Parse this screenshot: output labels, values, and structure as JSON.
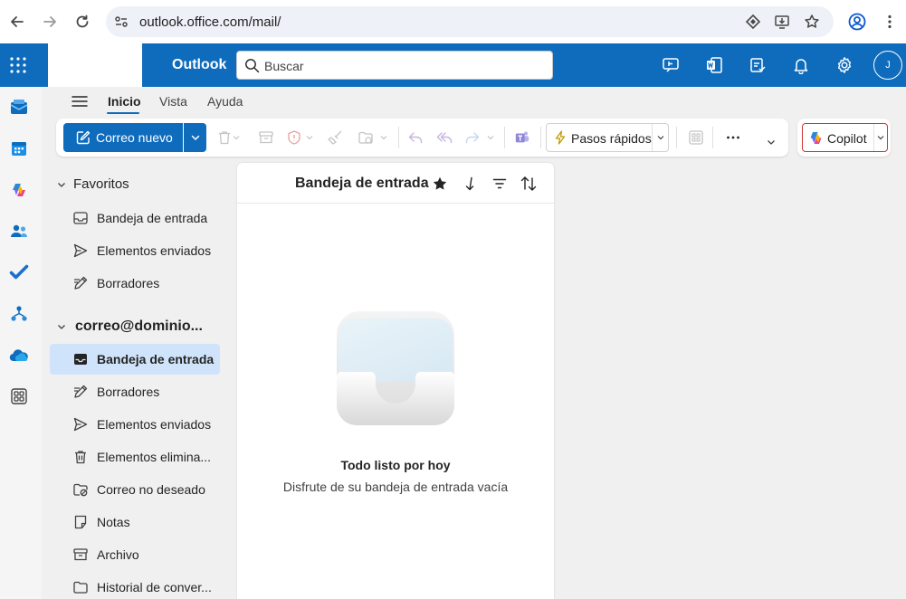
{
  "browser": {
    "url": "outlook.office.com/mail/"
  },
  "header": {
    "app_name": "Outlook",
    "search_placeholder": "Buscar",
    "avatar_initial": "J",
    "brand_color": "#0f6cbd"
  },
  "ribbon": {
    "tabs": [
      {
        "label": "Inicio",
        "active": true
      },
      {
        "label": "Vista",
        "active": false
      },
      {
        "label": "Ayuda",
        "active": false
      }
    ]
  },
  "toolbar": {
    "new_mail_label": "Correo nuevo",
    "quick_steps_label": "Pasos rápidos",
    "copilot_label": "Copilot",
    "more_label": "···"
  },
  "folders": {
    "favorites": {
      "title": "Favoritos",
      "items": [
        {
          "label": "Bandeja de entrada",
          "icon": "inbox-icon"
        },
        {
          "label": "Elementos enviados",
          "icon": "send-icon"
        },
        {
          "label": "Borradores",
          "icon": "drafts-icon"
        }
      ]
    },
    "account": {
      "title": "correo@dominio...",
      "items": [
        {
          "label": "Bandeja de entrada",
          "icon": "inbox-icon",
          "selected": true
        },
        {
          "label": "Borradores",
          "icon": "drafts-icon"
        },
        {
          "label": "Elementos enviados",
          "icon": "send-icon"
        },
        {
          "label": "Elementos elimina...",
          "icon": "trash-icon"
        },
        {
          "label": "Correo no deseado",
          "icon": "junk-icon"
        },
        {
          "label": "Notas",
          "icon": "notes-icon"
        },
        {
          "label": "Archivo",
          "icon": "archive-icon"
        },
        {
          "label": "Historial de conver...",
          "icon": "folder-icon"
        }
      ]
    }
  },
  "message_list": {
    "title": "Bandeja de entrada",
    "empty_title": "Todo listo por hoy",
    "empty_subtitle": "Disfrute de su bandeja de entrada vacía"
  }
}
